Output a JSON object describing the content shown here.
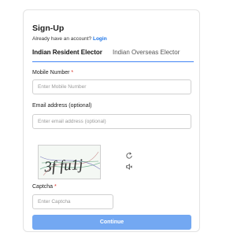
{
  "form": {
    "title": "Sign-Up",
    "login_prompt": "Already have an account?",
    "login_link": "Login",
    "tabs": [
      {
        "label": "Indian Resident Elector",
        "active": true
      },
      {
        "label": "Indian Overseas Elector",
        "active": false
      }
    ],
    "mobile": {
      "label": "Mobile Number",
      "required_mark": "*",
      "placeholder": "Enter Mobile Number",
      "value": ""
    },
    "email": {
      "label": "Email address (optional)",
      "placeholder": "Enter email address (optional)",
      "value": ""
    },
    "captcha": {
      "image_text": "3f fu1j",
      "refresh_icon": "refresh-icon",
      "audio_icon": "speaker-icon",
      "label": "Captcha",
      "required_mark": "*",
      "placeholder": "Enter Captcha",
      "value": ""
    },
    "continue_label": "Continue"
  },
  "colors": {
    "accent": "#1a73e8",
    "tab_indicator": "#4285f4",
    "button_bg": "#73a8f2",
    "required": "#d93025"
  }
}
